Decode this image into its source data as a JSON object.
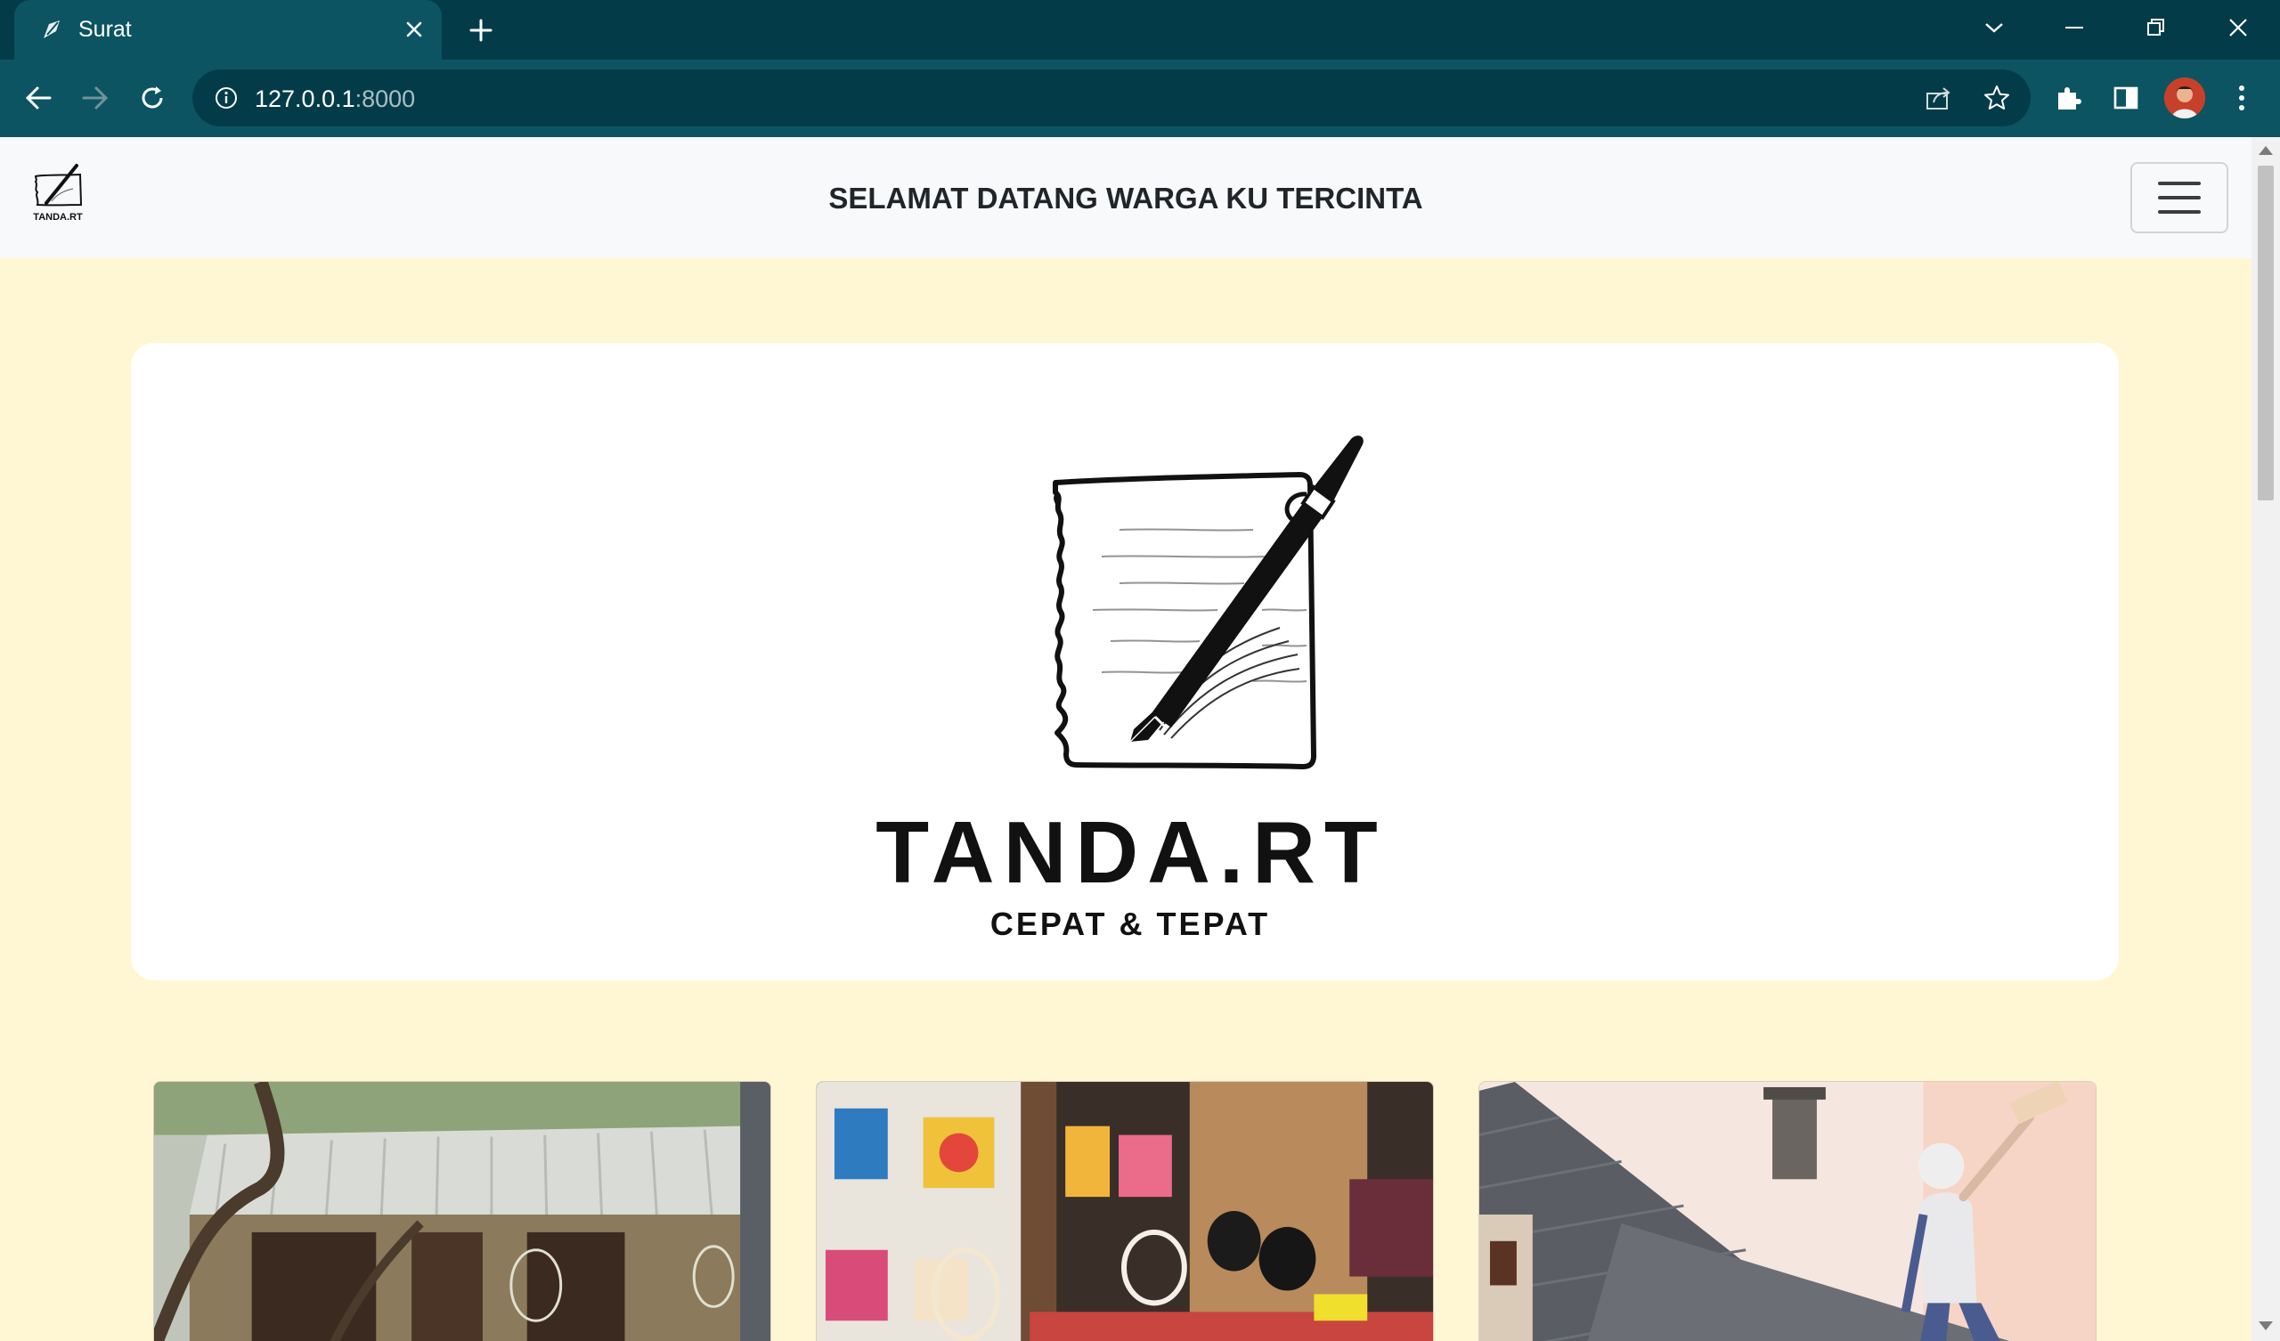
{
  "browser": {
    "tab_title": "Surat",
    "url_host": "127.0.0.1",
    "url_port": ":8000"
  },
  "navbar": {
    "logo_text": "TANDA.RT",
    "title": "SELAMAT DATANG WARGA KU TERCINTA"
  },
  "hero": {
    "brand": "TANDA.RT",
    "tagline": "CEPAT & TEPAT"
  },
  "cards": [
    {
      "image": "house-with-bird-cages"
    },
    {
      "image": "craft-shop-with-bags"
    },
    {
      "image": "roof-worker"
    }
  ],
  "colors": {
    "tabbar": "#033c48",
    "toolbar": "#0c5462",
    "page_bg": "#fff6d4",
    "navbar_bg": "#f8f9fa",
    "card_bg": "#ffffff"
  }
}
